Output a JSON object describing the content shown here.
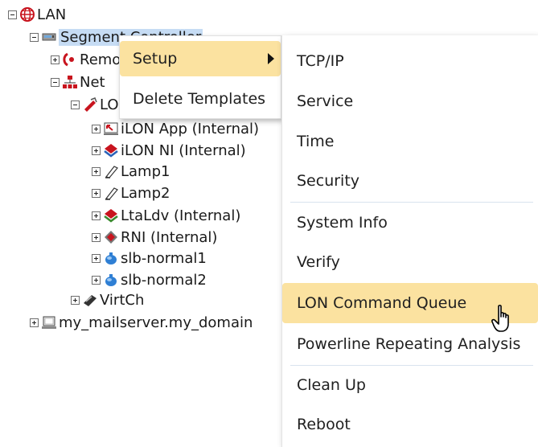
{
  "tree": {
    "root": "LAN",
    "segment": "Segment Controller",
    "remote": "Remote",
    "net": "Net",
    "lon": "LON",
    "devices": [
      "iLON App (Internal)",
      "iLON NI (Internal)",
      "Lamp1",
      "Lamp2",
      "LtaLdv (Internal)",
      "RNI (Internal)",
      "slb-normal1",
      "slb-normal2"
    ],
    "virt": "VirtCh",
    "server": "my_mailserver.my_domain"
  },
  "context_menu": {
    "items": [
      "Setup",
      "Delete Templates"
    ]
  },
  "submenu": {
    "items": [
      "TCP/IP",
      "Service",
      "Time",
      "Security",
      "System Info",
      "Verify",
      "LON Command Queue",
      "Powerline Repeating Analysis",
      "Clean Up",
      "Reboot"
    ]
  },
  "colors": {
    "highlight": "#fbe2a0",
    "selected_node": "#c6dcf4"
  }
}
